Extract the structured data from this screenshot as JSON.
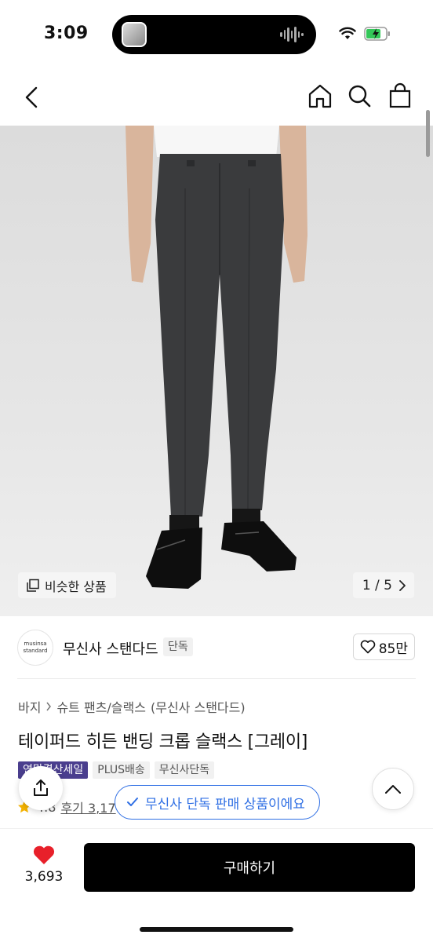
{
  "status_bar": {
    "time": "3:09"
  },
  "nav": {
    "back_icon": "chevron-left-icon",
    "home_icon": "home-icon",
    "search_icon": "search-icon",
    "cart_icon": "shopping-bag-icon"
  },
  "gallery": {
    "similar_label": "비슷한 상품",
    "page_counter": "1 / 5"
  },
  "brand": {
    "logo_line1": "musinsa",
    "logo_line2": "standard",
    "name": "무신사 스탠다드",
    "tag": "단독",
    "likes": "85만"
  },
  "product": {
    "breadcrumb": [
      "바지",
      "슈트 팬츠/슬랙스",
      "(무신사 스탠다드)"
    ],
    "title": "테이퍼드 히든 밴딩 크롭 슬랙스 [그레이]",
    "badges": [
      "연말결산세일",
      "PLUS배송",
      "무신사단독"
    ],
    "rating": "4.8",
    "reviews": "후기 3,17"
  },
  "toast": {
    "text": "무신사 단독 판매 상품이에요"
  },
  "bottom": {
    "wishlist_count": "3,693",
    "buy_label": "구매하기"
  },
  "colors": {
    "accent_blue": "#2f6fe4",
    "sale_badge": "#4a3e8e",
    "heart_red": "#e8202a",
    "star_yellow": "#f5b301"
  }
}
